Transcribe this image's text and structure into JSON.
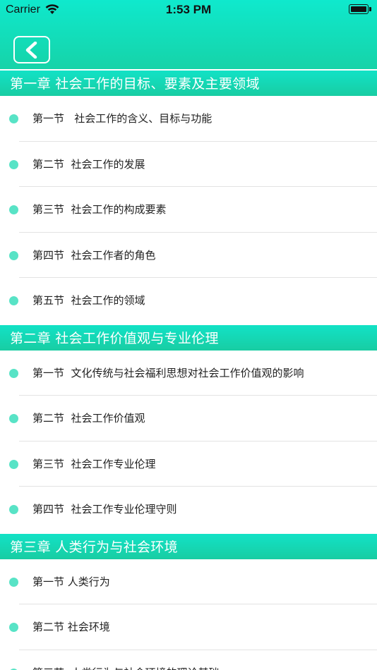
{
  "status_bar": {
    "carrier": "Carrier",
    "time": "1:53 PM",
    "wifi_icon": "wifi-icon",
    "battery_icon": "battery-icon"
  },
  "nav": {
    "back_icon": "chevron-left-icon"
  },
  "colors": {
    "accent": "#16d3a8",
    "dot": "#58e3c6",
    "separator": "#e3e3e3"
  },
  "chapters": [
    {
      "title": "第一章 社会工作的目标、要素及主要领域",
      "sections": [
        {
          "label": "第一节   社会工作的含义、目标与功能"
        },
        {
          "label": "第二节  社会工作的发展"
        },
        {
          "label": "第三节  社会工作的构成要素"
        },
        {
          "label": "第四节  社会工作者的角色"
        },
        {
          "label": "第五节  社会工作的领域"
        }
      ]
    },
    {
      "title": "第二章 社会工作价值观与专业伦理",
      "sections": [
        {
          "label": "第一节  文化传统与社会福利思想对社会工作价值观的影响"
        },
        {
          "label": "第二节  社会工作价值观"
        },
        {
          "label": "第三节  社会工作专业伦理"
        },
        {
          "label": "第四节  社会工作专业伦理守则"
        }
      ]
    },
    {
      "title": "第三章  人类行为与社会环境",
      "sections": [
        {
          "label": "第一节 人类行为"
        },
        {
          "label": "第二节 社会环境"
        },
        {
          "label": "第三节  人类行为与社会环境的理论基础"
        }
      ]
    }
  ]
}
